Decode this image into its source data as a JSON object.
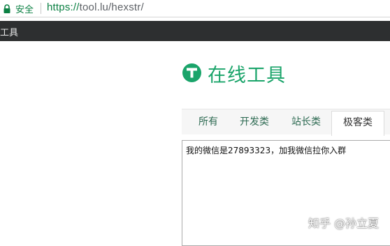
{
  "browser": {
    "secure_label": "安全",
    "url_scheme": "https://",
    "url_rest": "tool.lu/hexstr/",
    "lock_icon": "lock-icon",
    "secure_color": "#0b8043"
  },
  "bookmarks": {
    "items": [
      {
        "label": "工具"
      }
    ]
  },
  "site": {
    "title": "在线工具",
    "logo_icon": "t-logo-icon",
    "brand_color": "#1aa46a"
  },
  "tabs": [
    {
      "label": "所有",
      "active": false
    },
    {
      "label": "开发类",
      "active": false
    },
    {
      "label": "站长类",
      "active": false
    },
    {
      "label": "极客类",
      "active": true
    }
  ],
  "editor": {
    "value": "我的微信是27893323，加我微信拉你入群"
  },
  "watermark": {
    "text": "知乎 @孙立夏"
  }
}
